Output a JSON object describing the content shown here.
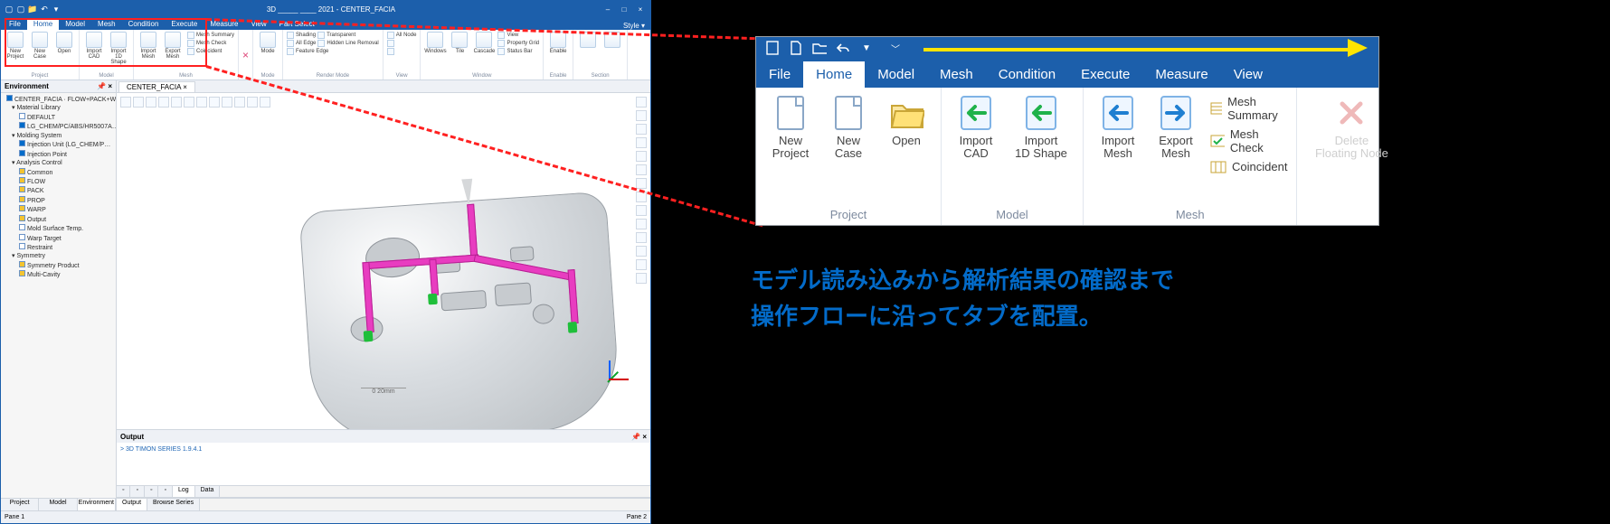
{
  "app": {
    "title": "3D _____ ____ 2021 - CENTER_FACIA",
    "qat": [
      "new-icon",
      "open-icon",
      "save-icon",
      "undo-icon",
      "redo-icon"
    ],
    "window_buttons": [
      "–",
      "□",
      "×"
    ],
    "tabs": [
      "File",
      "Home",
      "Model",
      "Mesh",
      "Condition",
      "Execute",
      "Measure",
      "View",
      "Part Select"
    ],
    "active_tab": "Home",
    "style_label": "Style ▾",
    "ribbon": {
      "project": {
        "label": "Project",
        "buttons": [
          {
            "name": "new-project",
            "label": "New\nProject"
          },
          {
            "name": "new-case",
            "label": "New\nCase"
          },
          {
            "name": "open",
            "label": "Open"
          }
        ]
      },
      "model": {
        "label": "Model",
        "buttons": [
          {
            "name": "import-cad",
            "label": "Import\nCAD"
          },
          {
            "name": "import-1d",
            "label": "Import\n1D Shape"
          }
        ]
      },
      "mesh": {
        "label": "Mesh",
        "buttons": [
          {
            "name": "import-mesh",
            "label": "Import\nMesh"
          },
          {
            "name": "export-mesh",
            "label": "Export\nMesh"
          }
        ],
        "mini": [
          "Mesh Summary",
          "Mesh Check",
          "Coincident"
        ]
      },
      "delete_x": "×",
      "mode": {
        "label": "Mode",
        "buttons": [
          {
            "name": "mode",
            "label": "Mode"
          }
        ]
      },
      "rendermode": {
        "label": "Render Mode",
        "mini": [
          "Shading",
          "All Edge",
          "Feature Edge",
          "Transparent",
          "Hidden Line Removal"
        ]
      },
      "view": {
        "label": "View",
        "mini": [
          "All Node",
          "",
          "",
          ""
        ]
      },
      "window": {
        "label": "Window",
        "buttons": [
          {
            "name": "windows",
            "label": "Windows"
          },
          {
            "name": "tile",
            "label": "Tile"
          },
          {
            "name": "cascade",
            "label": "Cascade"
          }
        ],
        "mini": [
          "View",
          "Property Grid",
          "Status Bar"
        ]
      },
      "enable": {
        "label": "Enable",
        "buttons": [
          {
            "name": "enable",
            "label": "Enable"
          }
        ]
      },
      "section": {
        "label": "Section"
      }
    },
    "env": {
      "title": "Environment",
      "root": "CENTER_FACIA · FLOW+PACK+WA…",
      "nodes": [
        {
          "lvl": 1,
          "t": "Material Library"
        },
        {
          "lvl": 2,
          "t": "DEFAULT"
        },
        {
          "lvl": 2,
          "t": "LG_CHEM/PC/ABS/HR5007A…"
        },
        {
          "lvl": 1,
          "t": "Molding System"
        },
        {
          "lvl": 2,
          "t": "Injection Unit (LG_CHEM/P…"
        },
        {
          "lvl": 2,
          "t": "Injection Point"
        },
        {
          "lvl": 1,
          "t": "Analysis Control"
        },
        {
          "lvl": 2,
          "t": "Common"
        },
        {
          "lvl": 2,
          "t": "FLOW"
        },
        {
          "lvl": 2,
          "t": "PACK"
        },
        {
          "lvl": 2,
          "t": "PROP"
        },
        {
          "lvl": 2,
          "t": "WARP"
        },
        {
          "lvl": 2,
          "t": "Output"
        },
        {
          "lvl": 2,
          "t": "Mold Surface Temp."
        },
        {
          "lvl": 2,
          "t": "Warp Target"
        },
        {
          "lvl": 2,
          "t": "Restraint"
        },
        {
          "lvl": 1,
          "t": "Symmetry"
        },
        {
          "lvl": 2,
          "t": "Symmetry Product"
        },
        {
          "lvl": 2,
          "t": "Multi-Cavity"
        }
      ],
      "tabs": [
        "Project",
        "Model",
        "Environment"
      ],
      "active": "Environment"
    },
    "doc_tab": "CENTER_FACIA",
    "doc_close": "×",
    "scale": "0        20mm",
    "output": {
      "title": "Output",
      "line": ">  3D TIMON SERIES 1.9.4.1",
      "toolicons": [
        "a",
        "b",
        "c",
        "d"
      ],
      "tabs": [
        "Log",
        "Data"
      ],
      "active": "Log",
      "bottom_tabs": [
        "Output",
        "Browse Series"
      ],
      "bottom_active": "Output"
    },
    "status_left": "Pane 1",
    "status_right": "Pane 2"
  },
  "callout": {
    "qat": [
      "new-icon",
      "open-icon",
      "folder-icon",
      "undo-icon"
    ],
    "tabs": [
      "File",
      "Home",
      "Model",
      "Mesh",
      "Condition",
      "Execute",
      "Measure",
      "View"
    ],
    "active": "Home",
    "groups": {
      "project": {
        "label": "Project",
        "buttons": [
          {
            "name": "new-project",
            "label": "New\nProject"
          },
          {
            "name": "new-case",
            "label": "New\nCase"
          },
          {
            "name": "open",
            "label": "Open"
          }
        ]
      },
      "model": {
        "label": "Model",
        "buttons": [
          {
            "name": "import-cad",
            "label": "Import\nCAD"
          },
          {
            "name": "import-1d",
            "label": "Import\n1D Shape"
          }
        ]
      },
      "mesh": {
        "label": "Mesh",
        "buttons": [
          {
            "name": "import-mesh",
            "label": "Import\nMesh"
          },
          {
            "name": "export-mesh",
            "label": "Export\nMesh"
          }
        ],
        "mini": [
          "Mesh Summary",
          "Mesh Check",
          "Coincident"
        ]
      },
      "delete": {
        "label": "Delete\nFloating Node",
        "name": "delete-floating-node"
      }
    }
  },
  "caption": {
    "line1": "モデル読み込みから解析結果の確認まで",
    "line2": "操作フローに沿ってタブを配置。"
  }
}
